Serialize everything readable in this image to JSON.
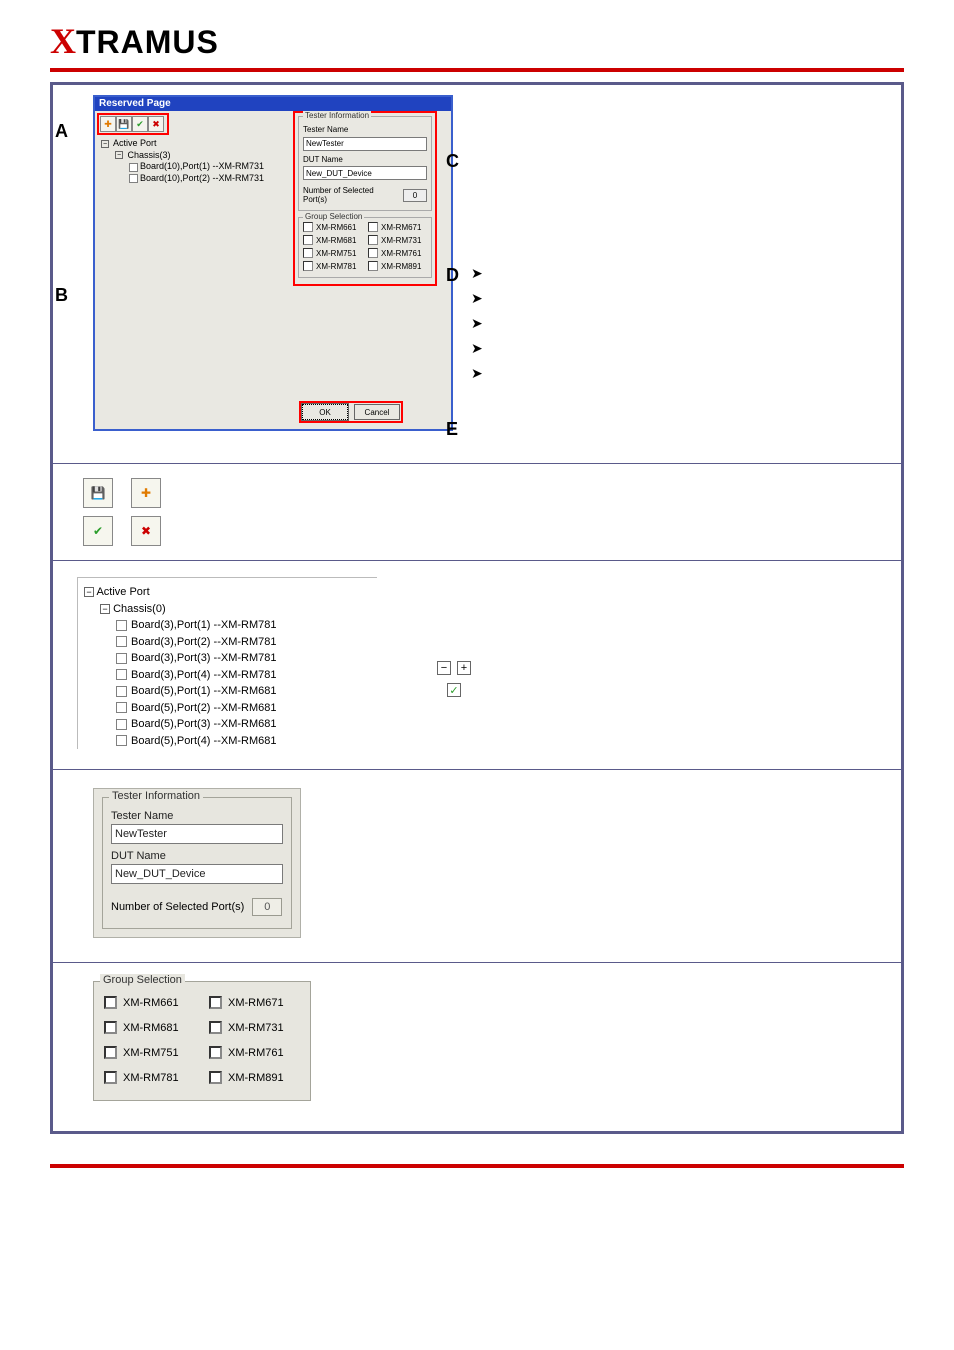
{
  "logo": {
    "x": "X",
    "rest": "TRAMUS"
  },
  "dialog": {
    "title": "Reserved Page",
    "toolbar_icons": [
      "plus-icon",
      "save-icon",
      "check-icon",
      "delete-icon"
    ],
    "tree": {
      "root": "Active Port",
      "chassis": "Chassis(3)",
      "items": [
        "Board(10),Port(1) --XM-RM731",
        "Board(10),Port(2) --XM-RM731"
      ]
    },
    "tester_info": {
      "legend": "Tester Information",
      "tester_label": "Tester Name",
      "tester_value": "NewTester",
      "dut_label": "DUT Name",
      "dut_value": "New_DUT_Device",
      "ports_label": "Number of Selected Port(s)",
      "ports_value": "0"
    },
    "group_sel": {
      "legend": "Group Selection",
      "items": [
        "XM-RM661",
        "XM-RM671",
        "XM-RM681",
        "XM-RM731",
        "XM-RM751",
        "XM-RM761",
        "XM-RM781",
        "XM-RM891"
      ]
    },
    "buttons": {
      "ok": "OK",
      "cancel": "Cancel"
    },
    "markers": {
      "A": "A",
      "B": "B",
      "C": "C",
      "D": "D",
      "E": "E"
    }
  },
  "active_port_tree": {
    "root": "Active Port",
    "chassis": "Chassis(0)",
    "items": [
      "Board(3),Port(1) --XM-RM781",
      "Board(3),Port(2) --XM-RM781",
      "Board(3),Port(3) --XM-RM781",
      "Board(3),Port(4) --XM-RM781",
      "Board(5),Port(1) --XM-RM681",
      "Board(5),Port(2) --XM-RM681",
      "Board(5),Port(3) --XM-RM681",
      "Board(5),Port(4) --XM-RM681"
    ],
    "expand_minus": "−",
    "expand_plus": "+",
    "check": "✓"
  },
  "tester_info_panel": {
    "legend": "Tester Information",
    "tester_label": "Tester Name",
    "tester_value": "NewTester",
    "dut_label": "DUT Name",
    "dut_value": "New_DUT_Device",
    "ports_label": "Number of Selected Port(s)",
    "ports_value": "0"
  },
  "group_selection_panel": {
    "legend": "Group Selection",
    "items": [
      "XM-RM661",
      "XM-RM671",
      "XM-RM681",
      "XM-RM731",
      "XM-RM751",
      "XM-RM761",
      "XM-RM781",
      "XM-RM891"
    ]
  }
}
